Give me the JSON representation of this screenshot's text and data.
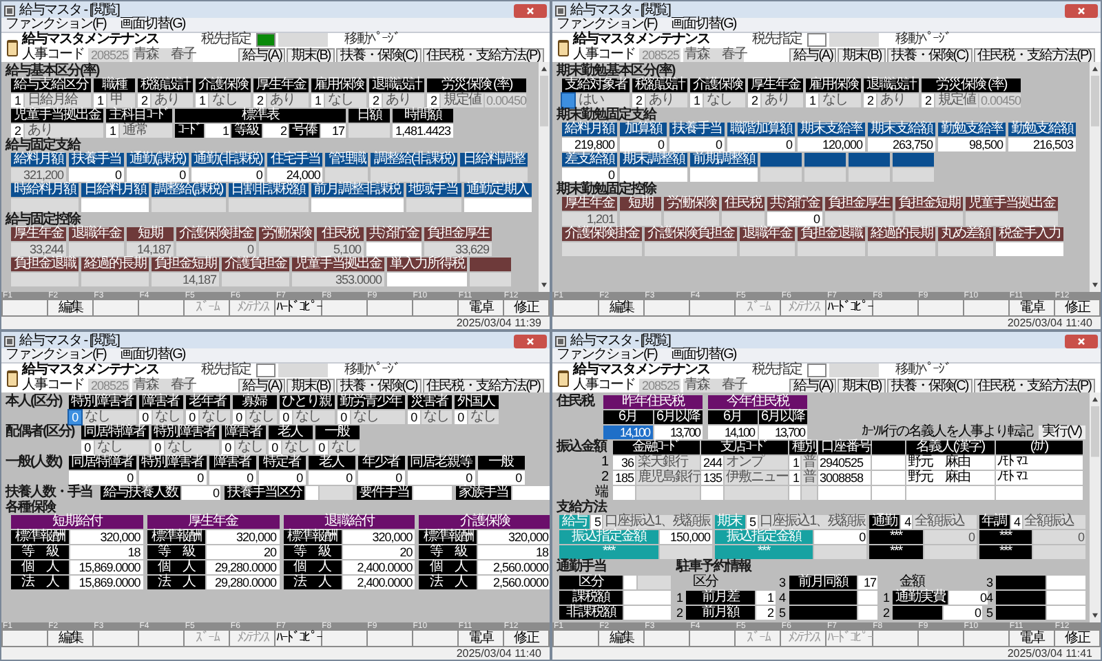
{
  "windows": [
    {
      "title": "給与マスタ - [閲覧]",
      "menu": [
        "ファンクション(F)",
        "画面切替(G)"
      ],
      "header": {
        "app_title": "給与マスタメンテナンス",
        "code_label": "人事コード",
        "code": "208525",
        "name": "青森　春子",
        "designation_label": "税先指定",
        "designation_set": true,
        "nav_label": "移動ﾍﾟｰｼﾞ",
        "nav_buttons": [
          "給与(A)",
          "期末(B)",
          "扶養・保険(C)",
          "住民税・支給方法(P)"
        ]
      },
      "sections": [
        {
          "kind": "basic",
          "title": "給与基本区分(率)",
          "fields": [
            {
              "label": "給与支給区分",
              "code": "1",
              "value": "日給月給"
            },
            {
              "label": "職種",
              "code": "1",
              "value": "甲"
            },
            {
              "label": "税額設計",
              "code": "2",
              "value": "あり"
            },
            {
              "label": "介護保険",
              "code": "1",
              "value": "なし"
            },
            {
              "label": "厚生年金",
              "code": "2",
              "value": "あり"
            },
            {
              "label": "雇用保険",
              "code": "1",
              "value": "なし"
            },
            {
              "label": "退職設計",
              "code": "2",
              "value": "あり"
            },
            {
              "label": "労災保険 (率)",
              "code": "2",
              "value": "規定値",
              "extra": "0.00450"
            },
            {
              "label": "児童手当拠出金",
              "code": "2",
              "value": "あり"
            },
            {
              "label": "主科目ｺｰﾄﾞ",
              "code": "1",
              "value": "通常"
            },
            {
              "label": "標準表",
              "parts": [
                {
                  "label": "ｺｰﾄﾞ",
                  "value": "1"
                },
                {
                  "label": "等級",
                  "value": "2"
                },
                {
                  "label": "号俸",
                  "value": "17"
                }
              ]
            },
            {
              "label": "日額"
            },
            {
              "label": "時間額",
              "value": "1,481.4423",
              "numeric": true,
              "editable": true
            }
          ]
        },
        {
          "kind": "allowance",
          "title": "給与固定支給",
          "fields": [
            {
              "label": "給料月額",
              "value": "321,200",
              "numeric": true
            },
            {
              "label": "扶養手当",
              "value": "0",
              "numeric": true,
              "editable": true
            },
            {
              "label": "通勤(課税)",
              "value": "0",
              "numeric": true,
              "editable": true
            },
            {
              "label": "通勤(非課税)",
              "value": "0",
              "numeric": true,
              "editable": true
            },
            {
              "label": "住宅手当",
              "value": "24,000",
              "numeric": true,
              "editable": true
            },
            {
              "label": "管理職"
            },
            {
              "label": "調整給(非課税)"
            },
            {
              "label": "日給料調整"
            },
            {
              "label": "時給料月額"
            },
            {
              "label": "日給料月額",
              "editable": true
            },
            {
              "label": "調整給(課税)"
            },
            {
              "label": "日割非課税額"
            },
            {
              "label": "前月調整非課税",
              "editable": true
            },
            {
              "label": "地域手当"
            },
            {
              "label": "通勤定期入",
              "editable": true
            }
          ]
        },
        {
          "kind": "deduction",
          "title": "給与固定控除",
          "fields": [
            {
              "kind": "field",
              "label": "厚生年金",
              "value": "33,244",
              "numeric": true
            },
            {
              "kind": "field",
              "label": "退職年金"
            },
            {
              "kind": "field",
              "label": "短期",
              "value": "14,187",
              "numeric": true
            },
            {
              "kind": "field",
              "label": "介護保険掛金",
              "value": "0",
              "numeric": true
            },
            {
              "kind": "field",
              "label": "労働保険"
            },
            {
              "kind": "field",
              "label": "住民税",
              "value": "5,100",
              "numeric": true
            },
            {
              "kind": "field",
              "label": "共済貯金",
              "editable": true
            },
            {
              "kind": "field",
              "label": "負担金厚生",
              "value": "33,629",
              "numeric": true
            },
            {
              "kind": "field",
              "label": "負担金退職"
            },
            {
              "kind": "field",
              "label": "経過的長期"
            },
            {
              "kind": "field",
              "label": "負担金短期",
              "value": "14,187",
              "numeric": true
            },
            {
              "kind": "field",
              "label": "介護負担金"
            },
            {
              "kind": "field",
              "label": "児童手当拠出金",
              "value": "353.0000",
              "numeric": true
            },
            {
              "kind": "field",
              "label": "単入力所得税",
              "editable": true
            },
            {
              "kind": "blank"
            }
          ]
        }
      ],
      "fkeys": [
        {
          "key": "F1"
        },
        {
          "key": "F2",
          "label": "編集",
          "disabled": false
        },
        {
          "key": "F3"
        },
        {
          "key": "F4"
        },
        {
          "key": "F5",
          "label": "ｽﾞｰﾑ",
          "disabled": true
        },
        {
          "key": "F6",
          "label": "ﾒﾝﾃﾅﾝｽ",
          "disabled": true
        },
        {
          "key": "F7",
          "label": "ﾊｰﾄﾞｺﾋﾟｰ",
          "disabled": false
        },
        {
          "key": "F8"
        },
        {
          "key": "F9"
        },
        {
          "key": "F10"
        },
        {
          "key": "F11",
          "label": "電卓",
          "disabled": false
        },
        {
          "key": "F12",
          "label": "修正",
          "disabled": false
        }
      ],
      "timestamp": "2025/03/04 11:39"
    },
    {
      "title": "給与マスタ - [閲覧]",
      "menu": [
        "ファンクション(F)",
        "画面切替(G)"
      ],
      "header": {
        "app_title": "給与マスタメンテナンス",
        "code_label": "人事コード",
        "code": "208525",
        "name": "青森　春子",
        "designation_label": "税先指定",
        "designation_set": false,
        "nav_label": "移動ﾍﾟｰｼﾞ",
        "nav_buttons": [
          "給与(A)",
          "期末(B)",
          "扶養・保険(C)",
          "住民税・支給方法(P)"
        ]
      },
      "sections": [
        {
          "kind": "basic",
          "title": "期末勤勉基本区分(率)",
          "fields": [
            {
              "label": "支給対象者",
              "value": "はい",
              "focused": true
            },
            {
              "label": "税額設計",
              "code": "2",
              "value": "あり",
              "focused": false
            },
            {
              "label": "介護保険",
              "code": "1",
              "value": "なし",
              "focused": false
            },
            {
              "label": "厚生年金",
              "code": "2",
              "value": "あり",
              "focused": false
            },
            {
              "label": "雇用保険",
              "code": "1",
              "value": "なし",
              "focused": false
            },
            {
              "label": "退職設計",
              "code": "2",
              "value": "あり",
              "focused": false
            },
            {
              "label": "労災保険 (率)",
              "code": "2",
              "value": "規定値",
              "extra": "0.00450",
              "focused": false
            }
          ]
        },
        {
          "kind": "allowance",
          "title": "期末勤勉固定支給",
          "fields": [
            {
              "kind": "field",
              "label": "給料月額",
              "value": "219,800",
              "numeric": true,
              "editable": true
            },
            {
              "kind": "field",
              "label": "加算額",
              "value": "0",
              "numeric": true,
              "editable": true
            },
            {
              "kind": "field",
              "label": "扶養手当",
              "value": "0",
              "numeric": true,
              "editable": true
            },
            {
              "kind": "field",
              "label": "職階加算額",
              "value": "0",
              "numeric": true,
              "editable": true
            },
            {
              "kind": "field",
              "label": "期末支給率",
              "value": "120,000",
              "numeric": true,
              "editable": true
            },
            {
              "kind": "field",
              "label": "期末支給額",
              "value": "263,750",
              "numeric": true,
              "editable": true
            },
            {
              "kind": "field",
              "label": "勤勉支給率",
              "value": "98,500",
              "numeric": true,
              "editable": true
            },
            {
              "kind": "field",
              "label": "勤勉支給額",
              "value": "216,503",
              "numeric": true,
              "editable": true
            },
            {
              "kind": "field",
              "label": "差支給額",
              "value": "0",
              "numeric": true,
              "editable": true
            },
            {
              "kind": "field",
              "label": "期末調整額",
              "editable": true
            },
            {
              "kind": "field",
              "label": "前期調整額",
              "editable": true
            },
            {
              "kind": "blank"
            },
            {
              "kind": "blank"
            },
            {
              "kind": "blank"
            },
            {
              "kind": "blank"
            }
          ]
        },
        {
          "kind": "deduction",
          "title": "期末勤勉固定控除",
          "fields": [
            {
              "label": "厚生年金",
              "value": "1,201",
              "numeric": true
            },
            {
              "label": "短期"
            },
            {
              "label": "労働保険"
            },
            {
              "label": "住民税"
            },
            {
              "label": "共済貯金",
              "value": "0",
              "numeric": true,
              "editable": true
            },
            {
              "label": "負担金厚生"
            },
            {
              "label": "負担金短期"
            },
            {
              "label": "児童手当拠出金"
            },
            {
              "label": "介護保険掛金"
            },
            {
              "label": "介護保険負担金"
            },
            {
              "label": "退職年金"
            },
            {
              "label": "負担金退職"
            },
            {
              "label": "経過的長期"
            },
            {
              "label": "丸め差額"
            },
            {
              "label": "税金手入力",
              "editable": true
            }
          ]
        }
      ],
      "fkeys": [
        {
          "key": "F1"
        },
        {
          "key": "F2",
          "label": "編集",
          "disabled": false
        },
        {
          "key": "F3"
        },
        {
          "key": "F4"
        },
        {
          "key": "F5",
          "label": "ｽﾞｰﾑ",
          "disabled": true
        },
        {
          "key": "F6",
          "label": "ﾒﾝﾃﾅﾝｽ",
          "disabled": true
        },
        {
          "key": "F7",
          "label": "ﾊｰﾄﾞｺﾋﾟｰ",
          "disabled": false
        },
        {
          "key": "F8"
        },
        {
          "key": "F9"
        },
        {
          "key": "F10"
        },
        {
          "key": "F11",
          "label": "電卓",
          "disabled": false
        },
        {
          "key": "F12",
          "label": "修正",
          "disabled": false
        }
      ],
      "timestamp": "2025/03/04 11:40"
    },
    {
      "title": "給与マスタ - [閲覧]",
      "menu": [
        "ファンクション(F)",
        "画面切替(G)"
      ],
      "header": {
        "app_title": "給与マスタメンテナンス",
        "code_label": "人事コード",
        "code": "208525",
        "name": "青森　春子",
        "designation_label": "税先指定",
        "designation_set": false,
        "nav_label": "移動ﾍﾟｰｼﾞ",
        "nav_buttons": [
          "給与(A)",
          "期末(B)",
          "扶養・保険(C)",
          "住民税・支給方法(P)"
        ]
      },
      "sections": [
        {
          "kind": "side",
          "title": "本人(区分)",
          "fields": [
            {
              "label": "特別障害者",
              "code": "0",
              "value": "なし",
              "focused": true
            },
            {
              "label": "障害者",
              "code": "0",
              "value": "なし",
              "focused": false
            },
            {
              "label": "老年者",
              "code": "0",
              "value": "なし",
              "focused": false
            },
            {
              "label": "寡婦",
              "code": "0",
              "value": "なし",
              "focused": false
            },
            {
              "label": "ひとり親",
              "code": "0",
              "value": "なし",
              "focused": false
            },
            {
              "label": "勤労青少年",
              "code": "0",
              "value": "なし",
              "focused": false
            },
            {
              "label": "災害者",
              "code": "0",
              "value": "なし",
              "focused": false
            },
            {
              "label": "外国人",
              "code": "0",
              "value": "なし",
              "focused": false
            }
          ]
        },
        {
          "kind": "side",
          "title": "配偶者(区分)",
          "fields": [
            {
              "label": "同居特障者",
              "code": "0",
              "value": "なし"
            },
            {
              "label": "特別障害者",
              "code": "0",
              "value": "なし"
            },
            {
              "label": "障害者",
              "code": "0",
              "value": "なし"
            },
            {
              "label": "老人",
              "code": "0",
              "value": "なし"
            },
            {
              "label": "一般",
              "code": "0",
              "value": "なし"
            }
          ]
        },
        {
          "kind": "side",
          "title": "一般(人数)",
          "fields": [
            {
              "label": "同居特障者",
              "value": "0",
              "numeric": true,
              "editable": true
            },
            {
              "label": "特別障害者",
              "value": "0",
              "numeric": true,
              "editable": true
            },
            {
              "label": "障害者",
              "value": "0",
              "numeric": true,
              "editable": true
            },
            {
              "label": "特定者",
              "value": "0",
              "numeric": true,
              "editable": true
            },
            {
              "label": "老人",
              "value": "0",
              "numeric": true,
              "editable": true
            },
            {
              "label": "年少者",
              "value": "0",
              "numeric": true,
              "editable": true
            },
            {
              "label": "同居老親等",
              "value": "0",
              "numeric": true,
              "editable": true
            },
            {
              "label": "一般",
              "value": "0",
              "numeric": true,
              "editable": true
            }
          ]
        },
        {
          "kind": "inline",
          "title": "扶養人数・手当",
          "items": [
            {
              "label": "給与扶養人数",
              "value": "0",
              "editable": true
            },
            {
              "label": "扶養手当区分",
              "code_box": true
            },
            {
              "label": "要件手当",
              "editable": true
            },
            {
              "label": "家族手当",
              "editable": true
            }
          ]
        },
        {
          "kind": "insurance",
          "title": "各種保険",
          "tables": [
            {
              "title": "短期給付",
              "rows": [
                {
                  "label": "標準報酬",
                  "value": "320,000"
                },
                {
                  "label": "等　級",
                  "value": "18"
                },
                {
                  "label": "個　人",
                  "value": "15,869.0000"
                },
                {
                  "label": "法　人",
                  "value": "15,869.0000"
                }
              ]
            },
            {
              "title": "厚生年金",
              "rows": [
                {
                  "label": "標準報酬",
                  "value": "320,000"
                },
                {
                  "label": "等　級",
                  "value": "20"
                },
                {
                  "label": "個　人",
                  "value": "29,280.0000"
                },
                {
                  "label": "法　人",
                  "value": "29,280.0000"
                }
              ]
            },
            {
              "title": "退職給付",
              "rows": [
                {
                  "label": "標準報酬",
                  "value": "320,000"
                },
                {
                  "label": "等　級",
                  "value": "20"
                },
                {
                  "label": "個　人",
                  "value": "2,400.0000"
                },
                {
                  "label": "法　人",
                  "value": "2,400.0000"
                }
              ]
            },
            {
              "title": "介護保険",
              "rows": [
                {
                  "label": "標準報酬",
                  "value": "320,000"
                },
                {
                  "label": "等　級",
                  "value": "18"
                },
                {
                  "label": "個　人",
                  "value": "2,560.0000"
                },
                {
                  "label": "法　人",
                  "value": "2,560.0000"
                }
              ]
            }
          ]
        }
      ],
      "fkeys": [
        {
          "key": "F1"
        },
        {
          "key": "F2",
          "label": "編集",
          "disabled": false
        },
        {
          "key": "F3"
        },
        {
          "key": "F4"
        },
        {
          "key": "F5",
          "label": "ｽﾞｰﾑ",
          "disabled": true
        },
        {
          "key": "F6",
          "label": "ﾒﾝﾃﾅﾝｽ",
          "disabled": true
        },
        {
          "key": "F7",
          "label": "ﾊｰﾄﾞｺﾋﾟｰ",
          "disabled": false
        },
        {
          "key": "F8"
        },
        {
          "key": "F9"
        },
        {
          "key": "F10"
        },
        {
          "key": "F11",
          "label": "電卓",
          "disabled": false
        },
        {
          "key": "F12",
          "label": "修正",
          "disabled": false
        }
      ],
      "timestamp": "2025/03/04 11:40"
    },
    {
      "title": "給与マスタ - [閲覧]",
      "menu": [
        "ファンクション(F)",
        "画面切替(G)"
      ],
      "header": {
        "app_title": "給与マスタメンテナンス",
        "code_label": "人事コード",
        "code": "208525",
        "name": "青森　春子",
        "designation_label": "税先指定",
        "designation_set": false,
        "nav_label": "移動ﾍﾟｰｼﾞ",
        "nav_buttons": [
          "給与(A)",
          "期末(B)",
          "扶養・保険(C)",
          "住民税・支給方法(P)"
        ]
      },
      "sections": [
        {
          "kind": "resident_tax",
          "title": "住民税",
          "blocks": [
            {
              "title": "昨年住民税",
              "months": [
                "6月",
                "6月以降"
              ],
              "values": [
                {
                  "value": "14,100",
                  "selected": true
                },
                {
                  "value": "13,700",
                  "selected": false
                }
              ]
            },
            {
              "title": "今年住民税",
              "months": [
                "6月",
                "6月以降"
              ],
              "values": [
                {
                  "value": "14,100",
                  "selected": false
                },
                {
                  "value": "13,700",
                  "selected": false
                }
              ]
            }
          ],
          "note": "ｶｰｿﾙ行の名義人を人事より転記",
          "button": "実行(V)"
        },
        {
          "kind": "bank",
          "title": "振込金額",
          "columns": {
            "bank": "金融ｺｰﾄﾞ",
            "branch": "支店ｺｰﾄﾞ",
            "type": "種別",
            "account": "口座番号",
            "holder": "名義人(漢字)",
            "kana": "(ｶﾅ)"
          },
          "rows": [
            {
              "no": "1",
              "bank_code": "36",
              "bank_name": "楽天銀行",
              "branch_code": "244",
              "branch_name": "オンプ",
              "type_code": "1",
              "type": "普",
              "account": "2940525",
              "holder": "野元　麻由",
              "kana": "ﾉﾓﾄ ﾏﾕ"
            },
            {
              "no": "2",
              "bank_code": "185",
              "bank_name": "鹿児島銀行",
              "branch_code": "135",
              "branch_name": "伊敷ニュー",
              "type_code": "1",
              "type": "普",
              "account": "3008858",
              "holder": "野元　麻由",
              "kana": "ﾉﾓﾄ ﾏﾕ"
            },
            {
              "no": "端"
            }
          ]
        },
        {
          "kind": "payment",
          "title": "支給方法",
          "groups": [
            {
              "color": "#17a2a2",
              "label": "給与",
              "code": "5",
              "method": "口座振込1、残額振",
              "rows": [
                {
                  "label": "振込指定金額",
                  "value": "150,000",
                  "editable": true
                },
                {
                  "label": "***"
                }
              ]
            },
            {
              "color": "#17a2a2",
              "label": "期末",
              "code": "5",
              "method": "口座振込1、残額振",
              "rows": [
                {
                  "label": "振込指定金額",
                  "value": "0",
                  "editable": true
                },
                {
                  "label": "***"
                }
              ]
            },
            {
              "color": "#000000",
              "label": "通勤",
              "code": "4",
              "method": "全額振込",
              "rows": [
                {
                  "label": "***",
                  "value": "0"
                },
                {
                  "label": "***"
                }
              ]
            },
            {
              "color": "#000000",
              "label": "年調",
              "code": "4",
              "method": "全額振込",
              "rows": [
                {
                  "label": "***",
                  "value": "0"
                },
                {
                  "label": "***"
                }
              ]
            }
          ]
        },
        {
          "kind": "commute",
          "title": "通勤手当",
          "rows": [
            {
              "label": "区分",
              "code_box": true
            },
            {
              "label": "課税額",
              "editable": true
            },
            {
              "label": "非課税額",
              "editable": true
            }
          ],
          "parking_title": "駐車予約情報",
          "parking": [
            {
              "heading": "区分",
              "items": [
                {
                  "no": "3",
                  "label": "前月同額",
                  "value": "17"
                },
                {
                  "no": "1",
                  "label": "前月差",
                  "value": "1"
                },
                {
                  "no": "4"
                },
                {
                  "no": "2",
                  "label": "前月額",
                  "value": "2"
                },
                {
                  "no": "5"
                }
              ]
            },
            {
              "heading": "金額",
              "items": [
                {
                  "no": "3"
                },
                {
                  "no": "1",
                  "label": "通勤実費",
                  "value": "0"
                },
                {
                  "no": "4"
                },
                {
                  "no": "2",
                  "value": "0"
                },
                {
                  "no": "5"
                }
              ]
            }
          ]
        }
      ],
      "fkeys": [
        {
          "key": "F1"
        },
        {
          "key": "F2",
          "label": "編集",
          "disabled": false
        },
        {
          "key": "F3"
        },
        {
          "key": "F4"
        },
        {
          "key": "F5",
          "label": "ｽﾞｰﾑ",
          "disabled": true
        },
        {
          "key": "F6",
          "label": "ﾒﾝﾃﾅﾝｽ",
          "disabled": true
        },
        {
          "key": "F7",
          "label": "ﾊｰﾄﾞｺﾋﾟｰ",
          "disabled": true
        },
        {
          "key": "F8"
        },
        {
          "key": "F9"
        },
        {
          "key": "F10"
        },
        {
          "key": "F11",
          "label": "電卓",
          "disabled": false
        },
        {
          "key": "F12",
          "label": "修正",
          "disabled": false
        }
      ],
      "timestamp": "2025/03/04 11:41"
    }
  ]
}
